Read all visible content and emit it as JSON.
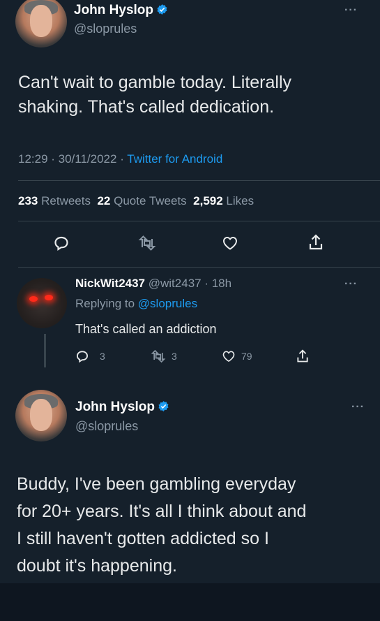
{
  "tweet1": {
    "author_name": "John Hyslop",
    "author_handle": "@sloprules",
    "text_line1": "Can't wait to gamble today. Literally",
    "text_line2": "shaking. That's called dedication.",
    "timestamp": "12:29 · 30/11/2022 · ",
    "source": "Twitter for Android",
    "retweets_count": "233",
    "retweets_label": "Retweets",
    "quotes_count": "22",
    "quotes_label": "Quote Tweets",
    "likes_count": "2,592",
    "likes_label": "Likes"
  },
  "reply": {
    "author_name": "NickWit2437",
    "author_handle_time": "@wit2437 · 18h",
    "replying_prefix": "Replying to ",
    "replying_handle": "@sloprules",
    "text": "That's called an addiction",
    "reply_count": "3",
    "retweet_count": "3",
    "like_count": "79"
  },
  "tweet2": {
    "author_name": "John Hyslop",
    "author_handle": "@sloprules",
    "text_line1": "Buddy, I've been gambling everyday",
    "text_line2": "for 20+ years. It's all I think about and",
    "text_line3": "I still haven't gotten addicted so I",
    "text_line4": "doubt it's happening."
  },
  "colors": {
    "background": "#15202b",
    "accent": "#1d9bf0",
    "muted": "#8b98a5",
    "bottom_bar": "#0e1620"
  },
  "icons": [
    "reply-icon",
    "retweet-icon",
    "like-icon",
    "share-icon",
    "verified-badge-icon",
    "more-options-icon"
  ]
}
